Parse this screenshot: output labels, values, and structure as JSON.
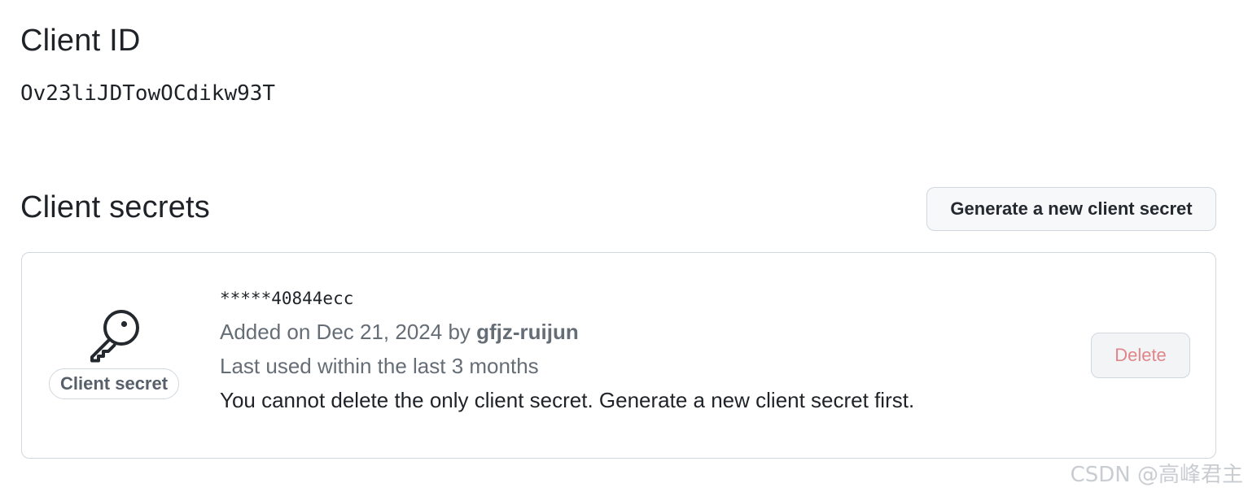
{
  "client_id": {
    "title": "Client ID",
    "value": "Ov23liJDTowOCdikw93T"
  },
  "client_secrets": {
    "title": "Client secrets",
    "generate_button_label": "Generate a new client secret",
    "secret": {
      "icon": "key-icon",
      "badge_label": "Client secret",
      "masked_value": "*****40844ecc",
      "added_prefix": "Added on Dec 21, 2024 by ",
      "added_author": "gfjz-ruijun",
      "last_used": "Last used within the last 3 months",
      "warning": "You cannot delete the only client secret. Generate a new client secret first.",
      "delete_button_label": "Delete"
    }
  },
  "watermark": "CSDN @高峰君主",
  "colors": {
    "text_primary": "#1f2328",
    "text_muted": "#656d76",
    "border": "#d0d7de",
    "button_bg": "#f6f8fa",
    "danger_disabled": "#e0858a"
  }
}
